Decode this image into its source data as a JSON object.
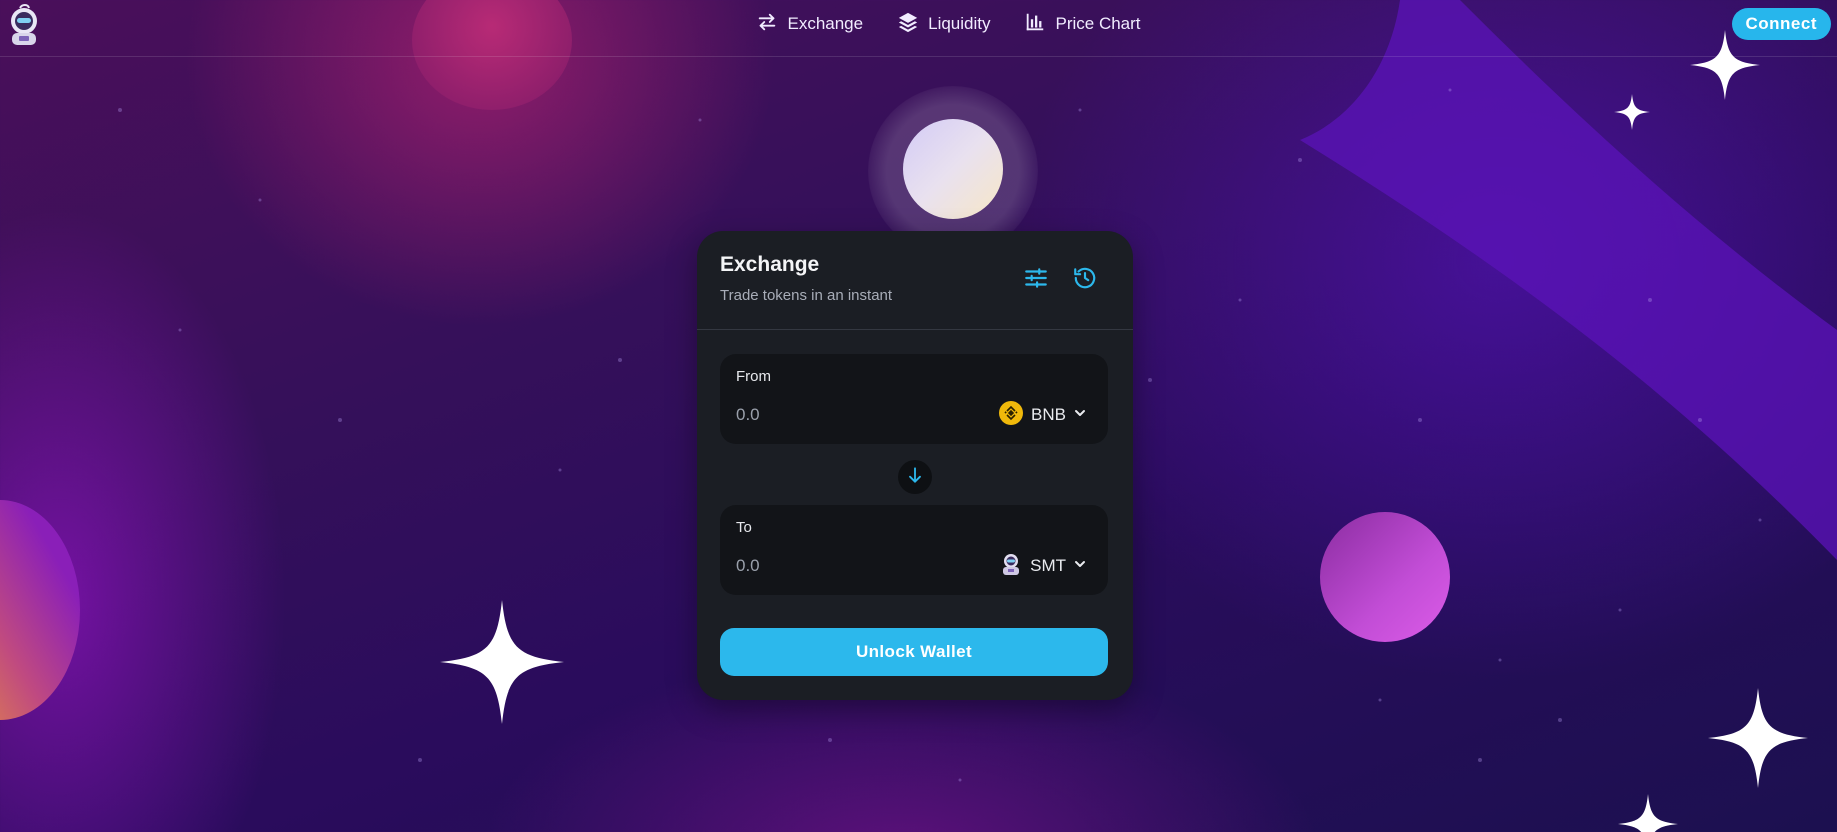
{
  "nav": {
    "items": [
      {
        "label": "Exchange",
        "icon": "swap-arrows-icon"
      },
      {
        "label": "Liquidity",
        "icon": "layers-icon"
      },
      {
        "label": "Price Chart",
        "icon": "bar-chart-icon"
      }
    ],
    "connect_label": "Connect"
  },
  "exchange": {
    "title": "Exchange",
    "subtitle": "Trade tokens in an instant",
    "from": {
      "label": "From",
      "placeholder": "0.0",
      "token": "BNB",
      "token_icon": "bnb-coin-icon"
    },
    "to": {
      "label": "To",
      "placeholder": "0.0",
      "token": "SMT",
      "token_icon": "smt-token-icon"
    },
    "unlock_label": "Unlock Wallet"
  },
  "colors": {
    "accent": "#2cb8ec",
    "card_bg": "#1b1e24",
    "input_bg": "#121418",
    "bnb": "#f0b90b"
  }
}
